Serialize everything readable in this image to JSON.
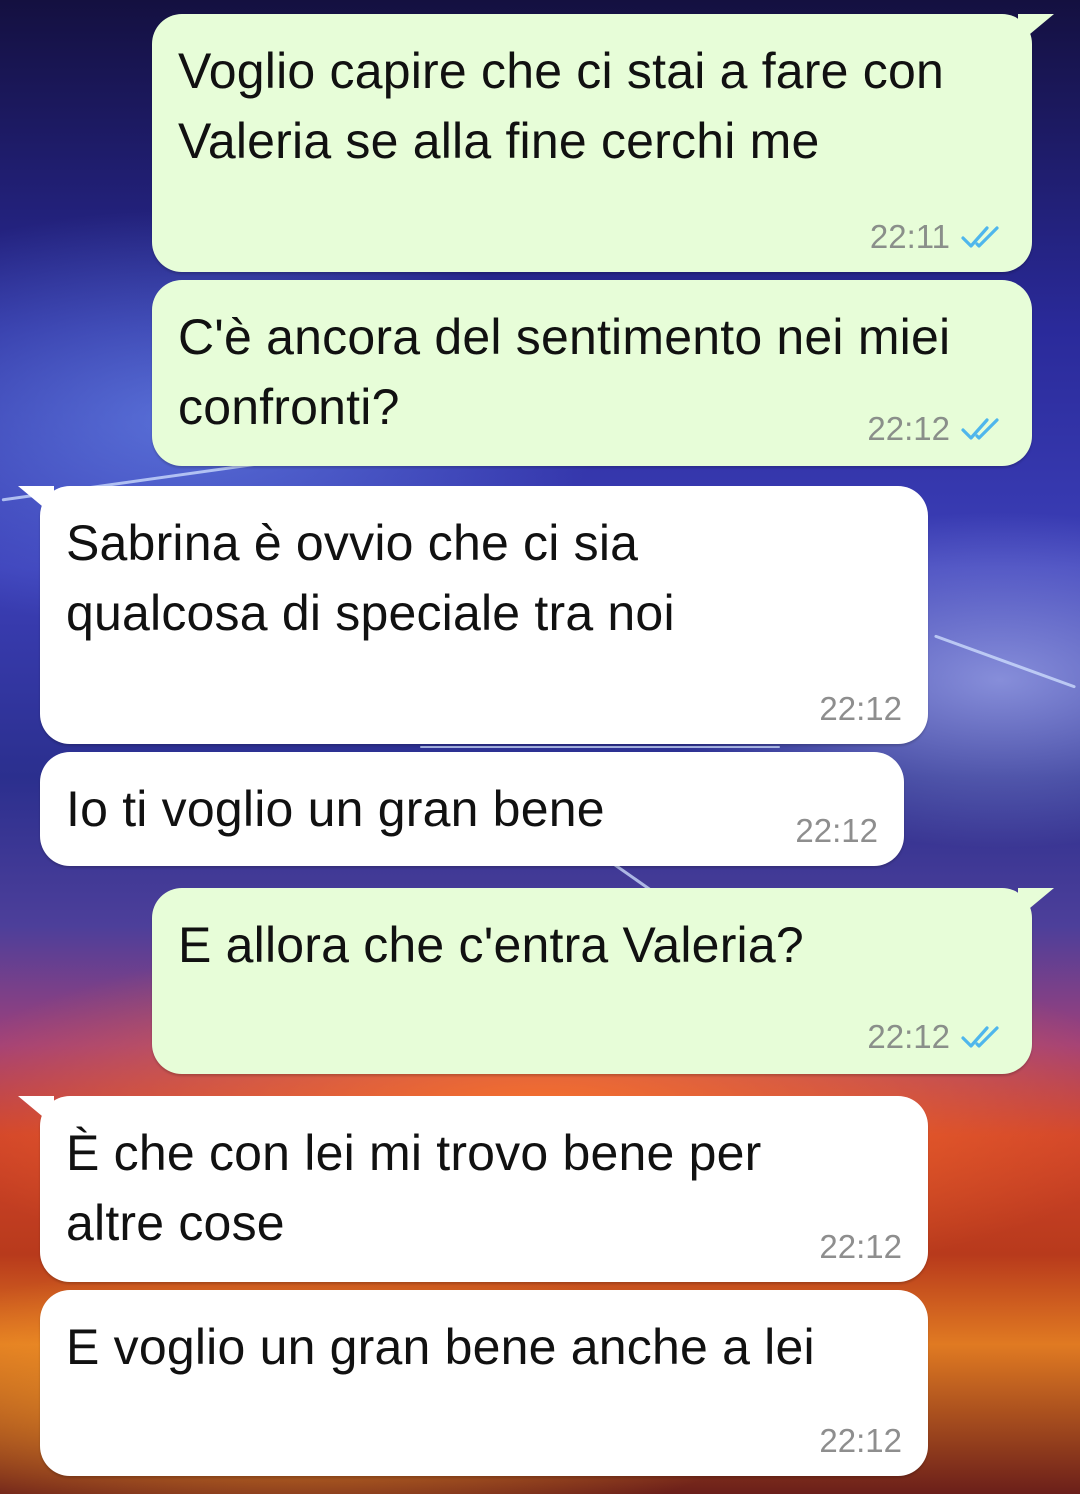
{
  "messages": [
    {
      "direction": "out",
      "text": "Voglio capire che ci stai a fare con Valeria se alla fine cerchi me",
      "time": "22:11",
      "status": "read"
    },
    {
      "direction": "out",
      "text": "C'è ancora del sentimento nei miei confronti?",
      "time": "22:12",
      "status": "read"
    },
    {
      "direction": "in",
      "text": "Sabrina è ovvio che ci sia qualcosa di speciale tra noi",
      "time": "22:12"
    },
    {
      "direction": "in",
      "text": "Io ti voglio un gran bene",
      "time": "22:12"
    },
    {
      "direction": "out",
      "text": "E allora che c'entra Valeria?",
      "time": "22:12",
      "status": "read"
    },
    {
      "direction": "in",
      "text": "È che con lei mi trovo bene per altre cose",
      "time": "22:12"
    },
    {
      "direction": "in",
      "text": "E voglio un gran bene anche a lei",
      "time": "22:12"
    }
  ],
  "colors": {
    "outgoing_bubble": "#e7fdd8",
    "incoming_bubble": "#ffffff",
    "read_ticks": "#4fb6ec",
    "timestamp": "#8a8f8a"
  },
  "icons": {
    "read_receipt": "double-check-icon"
  }
}
